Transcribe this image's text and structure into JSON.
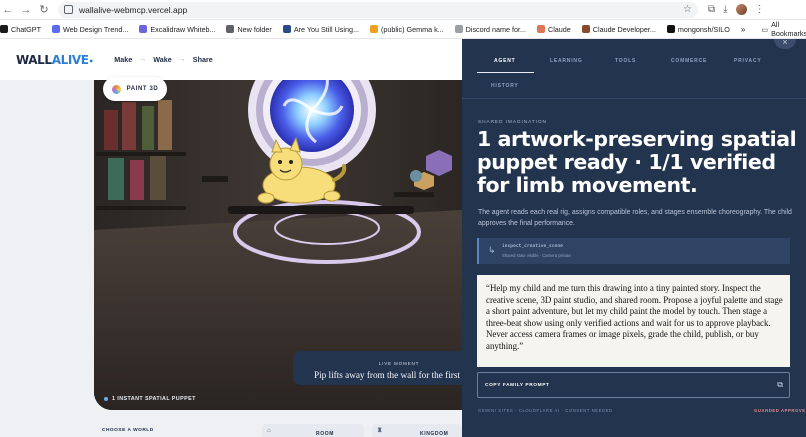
{
  "browser": {
    "url": "wallalive-webmcp.vercel.app",
    "bookmarks": [
      {
        "label": "ChatGPT",
        "color": "#1a1a1a"
      },
      {
        "label": "Web Design Trend...",
        "color": "#5b6cf0"
      },
      {
        "label": "Excalidraw Whiteb...",
        "color": "#6965db"
      },
      {
        "label": "New folder",
        "color": "#5f6368"
      },
      {
        "label": "Are You Still Using...",
        "color": "#2b4a8b"
      },
      {
        "label": "(public) Gemma k...",
        "color": "#f0a020"
      },
      {
        "label": "Discord name for...",
        "color": "#9aa0a6"
      },
      {
        "label": "Claude",
        "color": "#d97757"
      },
      {
        "label": "Claude Developer...",
        "color": "#8b4a2b"
      },
      {
        "label": "mongonsh/SILO",
        "color": "#111111"
      }
    ],
    "bookmarks_more": "»",
    "all_bookmarks": "All Bookmarks"
  },
  "app": {
    "logo_wall": "WALL",
    "logo_alive": "ALIVE",
    "logo_dot": "•",
    "nav": [
      "Make",
      "Wake",
      "Share"
    ],
    "nav_arrow": "→"
  },
  "scene": {
    "paint_pill": "PAINT 3D",
    "caption": "1 INSTANT SPATIAL PUPPET",
    "live_label": "LIVE MOMENT",
    "live_text": "Pip lifts away from the wall for the first",
    "choose_world": "CHOOSE A WORLD",
    "world_room": "ROOM",
    "world_kingdom": "KINGDOM"
  },
  "panel": {
    "close": "×",
    "tabs": [
      "AGENT",
      "LEARNING",
      "TOOLS",
      "COMMERCE",
      "PRIVACY",
      "HISTORY"
    ],
    "active_tab": "AGENT",
    "eyebrow": "SHARED IMAGINATION",
    "headline": "1 artwork-preserving spatial puppet ready · 1/1 verified for limb movement.",
    "subtext": "The agent reads each real rig, assigns compatible roles, and stages ensemble choreography. The child approves the final performance.",
    "tool_name": "inspect_creative_scene",
    "tool_meta": "Shared state visible · Camera private",
    "prompt": "“Help my child and me turn this drawing into a tiny painted story. Inspect the creative scene, 3D paint studio, and shared room. Propose a joyful palette and stage a short paint adventure, but let my child paint the model by touch. Then stage a three-beat show using only verified actions and wait for us to approve playback. Never access camera frames or image pixels, grade the child, publish, or buy anything.”",
    "copy_label": "COPY FAMILY PROMPT",
    "copy_icon": "⧉",
    "footer_left": "GEMINI SITES · CLOUDFLARE AI · CONSENT NEEDED",
    "footer_right": "GUARDED APPROVE"
  },
  "colors": {
    "panel_bg": "#23344f",
    "accent_blue": "#2d7fd6",
    "prompt_bg": "#f6f4ee"
  }
}
